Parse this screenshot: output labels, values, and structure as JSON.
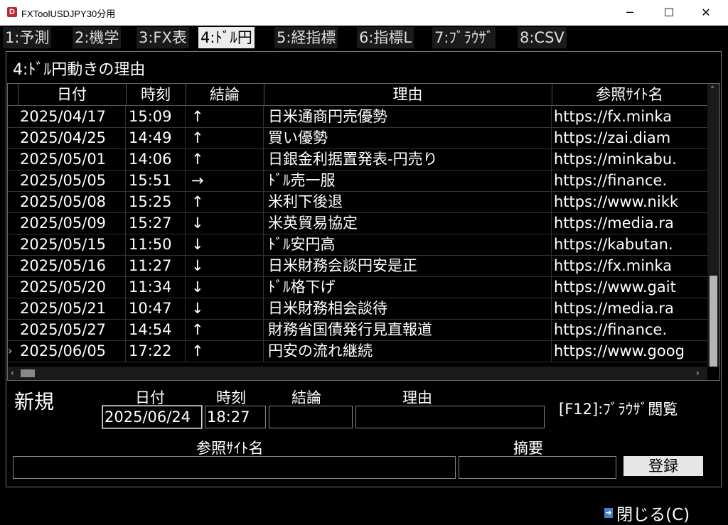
{
  "window": {
    "title": "FXToolUSDJPY30分用",
    "icon_letter": "D",
    "minimize": "─",
    "maximize": "☐",
    "close": "✕"
  },
  "tabs": [
    "1:予測",
    "2:機学",
    "3:FX表",
    "4:ﾄﾞﾙ円",
    "5:経指標",
    "6:指標L",
    "7:ﾌﾞﾗｳｻﾞ",
    "8:CSV"
  ],
  "section_title": "4:ﾄﾞﾙ円動きの理由",
  "grid": {
    "columns": [
      "日付",
      "時刻",
      "結論",
      "理由",
      "参照ｻｲﾄ名"
    ],
    "rows": [
      [
        "2025/04/17",
        "15:09",
        "↑",
        "日米通商円売優勢",
        "https://fx.minka"
      ],
      [
        "2025/04/25",
        "14:49",
        "↑",
        "買い優勢",
        "https://zai.diam"
      ],
      [
        "2025/05/01",
        "14:06",
        "↑",
        "日銀金利据置発表-円売り",
        "https://minkabu."
      ],
      [
        "2025/05/05",
        "15:51",
        "→",
        "ﾄﾞﾙ売一服",
        "https://finance."
      ],
      [
        "2025/05/08",
        "15:25",
        "↑",
        "米利下後退",
        "https://www.nikk"
      ],
      [
        "2025/05/09",
        "15:27",
        "↓",
        "米英貿易協定",
        "https://media.ra"
      ],
      [
        "2025/05/15",
        "11:50",
        "↓",
        "ﾄﾞﾙ安円高",
        "https://kabutan."
      ],
      [
        "2025/05/16",
        "11:27",
        "↓",
        "日米財務会談円安是正",
        "https://fx.minka"
      ],
      [
        "2025/05/20",
        "11:34",
        "↓",
        "ﾄﾞﾙ格下げ",
        "https://www.gait"
      ],
      [
        "2025/05/21",
        "10:47",
        "↓",
        "日米財務相会談待",
        "https://media.ra"
      ],
      [
        "2025/05/27",
        "14:54",
        "↑",
        "財務省国債発行見直報道",
        "https://finance."
      ],
      [
        "2025/06/05",
        "17:22",
        "↑",
        "円安の流れ継続",
        "https://www.goog"
      ]
    ],
    "current_row_marker": "›"
  },
  "form": {
    "new_label": "新規",
    "date_label": "日付",
    "time_label": "時刻",
    "conclusion_label": "結論",
    "reason_label": "理由",
    "date_value": "2025/06/24",
    "time_value": "18:27",
    "conclusion_value": "",
    "reason_value": "",
    "site_label": "参照ｻｲﾄ名",
    "summary_label": "摘要",
    "site_value": "",
    "summary_value": "",
    "register_button": "登録",
    "browse_hint": "[F12]:ﾌﾞﾗｳｻﾞ閲覧"
  },
  "footer": {
    "close_button": "閉じる(C)"
  },
  "colors": {
    "background": "#000000",
    "active_tab": "#ececec",
    "icon_red": "#c0272d"
  }
}
